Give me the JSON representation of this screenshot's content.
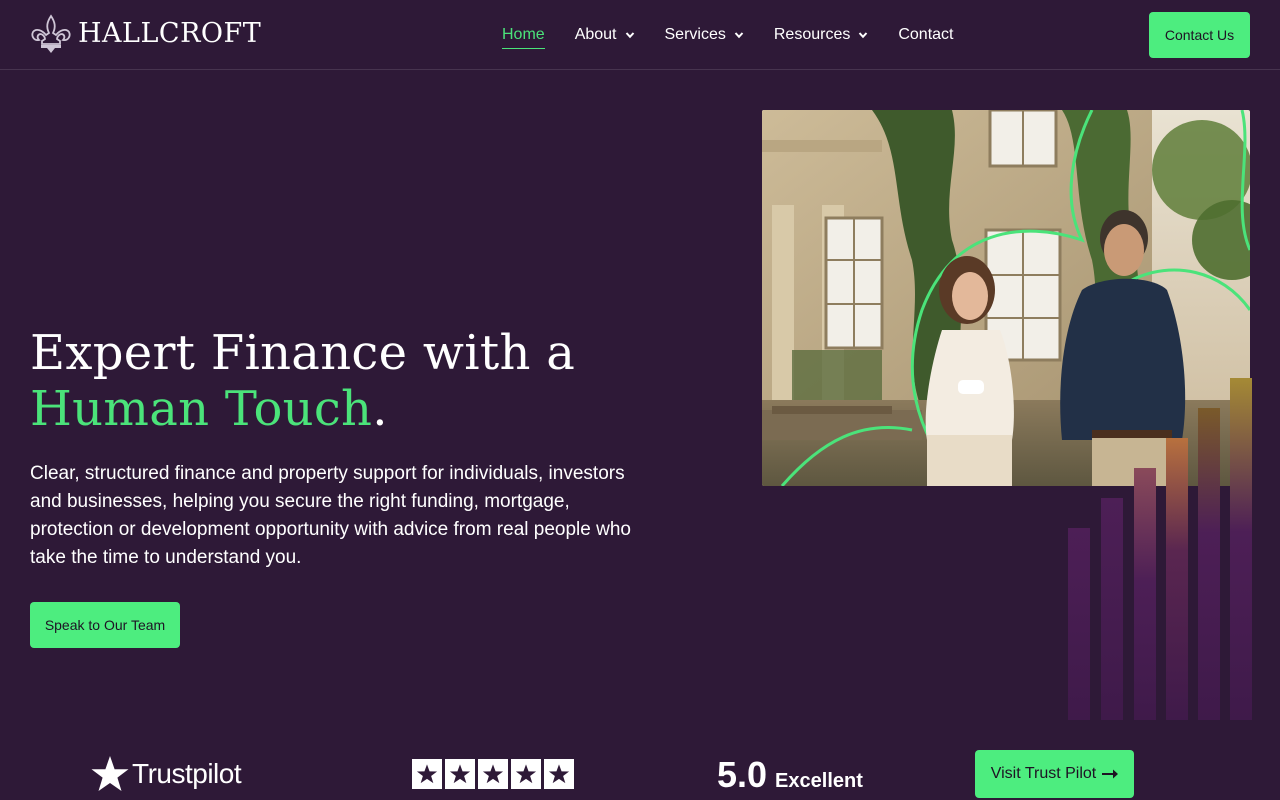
{
  "brand": {
    "name": "HALLCROFT",
    "logo_icon": "fleur-de-lis-icon"
  },
  "nav": {
    "items": [
      {
        "label": "Home",
        "active": true,
        "has_dropdown": false
      },
      {
        "label": "About",
        "active": false,
        "has_dropdown": true
      },
      {
        "label": "Services",
        "active": false,
        "has_dropdown": true
      },
      {
        "label": "Resources",
        "active": false,
        "has_dropdown": true
      },
      {
        "label": "Contact",
        "active": false,
        "has_dropdown": false
      }
    ],
    "cta_label": "Contact Us"
  },
  "hero": {
    "title_line1": "Expert Finance with a",
    "title_accent": "Human Touch",
    "title_end": ".",
    "description": "Clear, structured finance and property support for individuals, investors and businesses, helping you secure the right funding, mortgage, protection or development opportunity with advice from real people who take the time to understand you.",
    "cta_label": "Speak to Our Team"
  },
  "trust": {
    "brand": "Trustpilot",
    "stars": 5,
    "score": "5.0",
    "rating_word": "Excellent",
    "cta_label": "Visit Trust Pilot",
    "cta_icon": "arrow-right-icon"
  },
  "colors": {
    "background": "#2e1937",
    "accent": "#4be37a",
    "button": "#4ded7f",
    "button_text": "#1e1324"
  }
}
